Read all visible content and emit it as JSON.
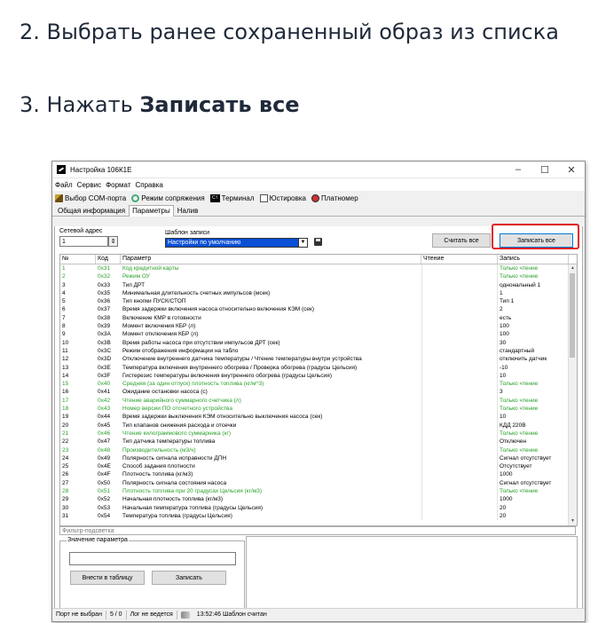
{
  "instructions": {
    "step2": "2. Выбрать ранее сохраненный образ из списка",
    "step3_prefix": "3. Нажать ",
    "step3_bold": "Записать все"
  },
  "window": {
    "title": "Настройка 106К1Е",
    "controls": {
      "minimize": "–",
      "maximize": "☐",
      "close": "✕"
    }
  },
  "menu": [
    "Файл",
    "Сервис",
    "Формат",
    "Справка"
  ],
  "toolbar": [
    {
      "label": "Выбор COM-порта",
      "icon": "com-port-icon"
    },
    {
      "label": "Режим сопряжения",
      "icon": "pairing-icon"
    },
    {
      "label": "Терминал",
      "icon": "terminal-icon"
    },
    {
      "label": "Юстировка",
      "icon": "adjust-icon"
    },
    {
      "label": "Платномер",
      "icon": "platnomer-icon"
    }
  ],
  "tabs": [
    "Общая информация",
    "Параметры",
    "Налив"
  ],
  "active_tab": "Параметры",
  "params": {
    "net_addr_label": "Сетевой адрес",
    "net_addr_value": "1",
    "template_label": "Шаблон записи",
    "template_value": "Настройки по умолчанию",
    "read_all": "Считать все",
    "write_all": "Записать все"
  },
  "table": {
    "headers": [
      "№",
      "Код",
      "Параметр",
      "Чтение",
      "Запись"
    ],
    "rows": [
      [
        "1",
        "0x31",
        "Код кредитной карты",
        "",
        "Только чтение",
        "g"
      ],
      [
        "2",
        "0x32",
        "Режим ОУ",
        "",
        "Только чтение",
        "g"
      ],
      [
        "3",
        "0x33",
        "Тип ДРТ",
        "",
        "однональный 1",
        ""
      ],
      [
        "4",
        "0x35",
        "Минимальная длительность счетных импульсов (мсек)",
        "",
        "1",
        ""
      ],
      [
        "5",
        "0x36",
        "Тип кнопки ПУСК/СТОП",
        "",
        "Тип 1",
        ""
      ],
      [
        "6",
        "0x37",
        "Время задержки включения насоса относительно включения КЭМ (сек)",
        "",
        "2",
        ""
      ],
      [
        "7",
        "0x38",
        "Включение КМР в готовности",
        "",
        "есть",
        ""
      ],
      [
        "8",
        "0x39",
        "Момент включения КБР (л)",
        "",
        "100",
        ""
      ],
      [
        "9",
        "0x3A",
        "Момент отключения КБР (л)",
        "",
        "100",
        ""
      ],
      [
        "10",
        "0x3B",
        "Время работы насоса при отсутствии импульсов ДРТ (сек)",
        "",
        "30",
        ""
      ],
      [
        "11",
        "0x3C",
        "Режим отображения информации на табло",
        "",
        "стандартный",
        ""
      ],
      [
        "12",
        "0x3D",
        "Отключение внутреннего датчика температуры / Чтение температуры внутри устройства",
        "",
        "отключить датчик",
        ""
      ],
      [
        "13",
        "0x3E",
        "Температура включения внутреннего обогрева / Проверка обогрева (градусы Цельсия)",
        "",
        "-10",
        ""
      ],
      [
        "14",
        "0x3F",
        "Гистерезис температуры включения внутреннего обогрева (градусы Цельсия)",
        "",
        "10",
        ""
      ],
      [
        "15",
        "0x40",
        "Средняя (за один отпуск) плотность топлива (кг/м^3)",
        "",
        "Только чтение",
        "g"
      ],
      [
        "16",
        "0x41",
        "Ожидание остановки насоса (с)",
        "",
        "3",
        ""
      ],
      [
        "17",
        "0x42",
        "Чтение аварийного суммарного счетчика (л)",
        "",
        "Только чтение",
        "g"
      ],
      [
        "18",
        "0x43",
        "Номер версии ПО отсчетного устройства",
        "",
        "Только чтение",
        "g"
      ],
      [
        "19",
        "0x44",
        "Время задержки выключения КЭМ относительно выключения насоса (сек)",
        "",
        "10",
        ""
      ],
      [
        "20",
        "0x45",
        "Тип клапанов снижения расхода и отсечки",
        "",
        "КДД 220В",
        ""
      ],
      [
        "21",
        "0x46",
        "Чтение килограммового суммарника (кг)",
        "",
        "Только чтение",
        "g"
      ],
      [
        "22",
        "0x47",
        "Тип датчика температуры топлива",
        "",
        "Отключен",
        ""
      ],
      [
        "23",
        "0x48",
        "Производительность (м3/ч)",
        "",
        "Только чтение",
        "g"
      ],
      [
        "24",
        "0x49",
        "Полярность сигнала исправности ДПН",
        "",
        "Сигнал отсутствует",
        ""
      ],
      [
        "25",
        "0x4E",
        "Способ задания плотности",
        "",
        "Отсутствует",
        ""
      ],
      [
        "26",
        "0x4F",
        "Плотность топлива (кг/м3)",
        "",
        "1000",
        ""
      ],
      [
        "27",
        "0x50",
        "Полярность сигнала состояния насоса",
        "",
        "Сигнал отсутствует",
        ""
      ],
      [
        "28",
        "0x51",
        "Плотность топлива при 20 градусах Цельсия (кг/м3)",
        "",
        "Только чтение",
        "g"
      ],
      [
        "29",
        "0x52",
        "Начальная плотность топлива (кг/м3)",
        "",
        "1000",
        ""
      ],
      [
        "30",
        "0x53",
        "Начальная температура топлива (градусы Цельсия)",
        "",
        "20",
        ""
      ],
      [
        "31",
        "0x54",
        "Температура топлива (градусы Цельсия)",
        "",
        "20",
        ""
      ]
    ]
  },
  "filter_placeholder": "Фильтр-подсветка",
  "value_group": {
    "label": "Значение параметра",
    "apply": "Внести в таблицу",
    "write": "Записать"
  },
  "status": {
    "port": "Порт не выбран",
    "count": "5 / 0",
    "log": "Лог не ведется",
    "message": "13:52:46 Шаблон считан"
  }
}
